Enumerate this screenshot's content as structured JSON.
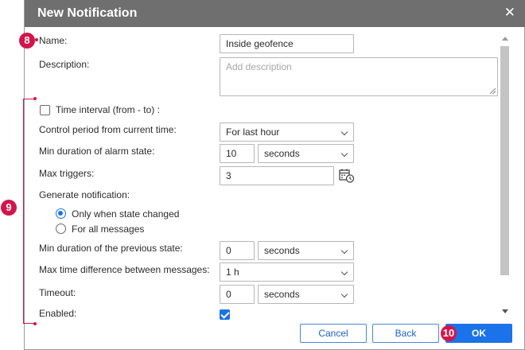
{
  "dialog": {
    "title": "New Notification",
    "close_glyph": "✕"
  },
  "form": {
    "name_label": "Name:",
    "name_value": "Inside geofence",
    "description_label": "Description:",
    "description_placeholder": "Add description",
    "time_interval_label": "Time interval (from - to)  :",
    "time_interval_checked": false,
    "control_period_label": "Control period from current time:",
    "control_period_value": "For last hour",
    "min_duration_alarm_label": "Min duration of alarm state:",
    "min_duration_alarm_value": "10",
    "min_duration_alarm_unit": "seconds",
    "max_triggers_label": "Max triggers:",
    "max_triggers_value": "3",
    "generate_label": "Generate notification:",
    "generate_options": [
      {
        "label": "Only when state changed",
        "selected": true
      },
      {
        "label": "For all messages",
        "selected": false
      }
    ],
    "min_duration_prev_label": "Min duration of the previous state:",
    "min_duration_prev_value": "0",
    "min_duration_prev_unit": "seconds",
    "max_time_diff_label": "Max time difference between messages:",
    "max_time_diff_value": "1 h",
    "timeout_label": "Timeout:",
    "timeout_value": "0",
    "timeout_unit": "seconds",
    "enabled_label": "Enabled:",
    "enabled_checked": true
  },
  "buttons": {
    "cancel": "Cancel",
    "back": "Back",
    "ok": "OK"
  },
  "annotations": {
    "badge_8": "8",
    "badge_9": "9",
    "badge_10": "10"
  },
  "icons": {
    "calendar": "calendar-clock-icon"
  },
  "colors": {
    "titlebar": "#6f6f6f",
    "accent": "#1a73e8",
    "annotation": "#d3154b"
  }
}
